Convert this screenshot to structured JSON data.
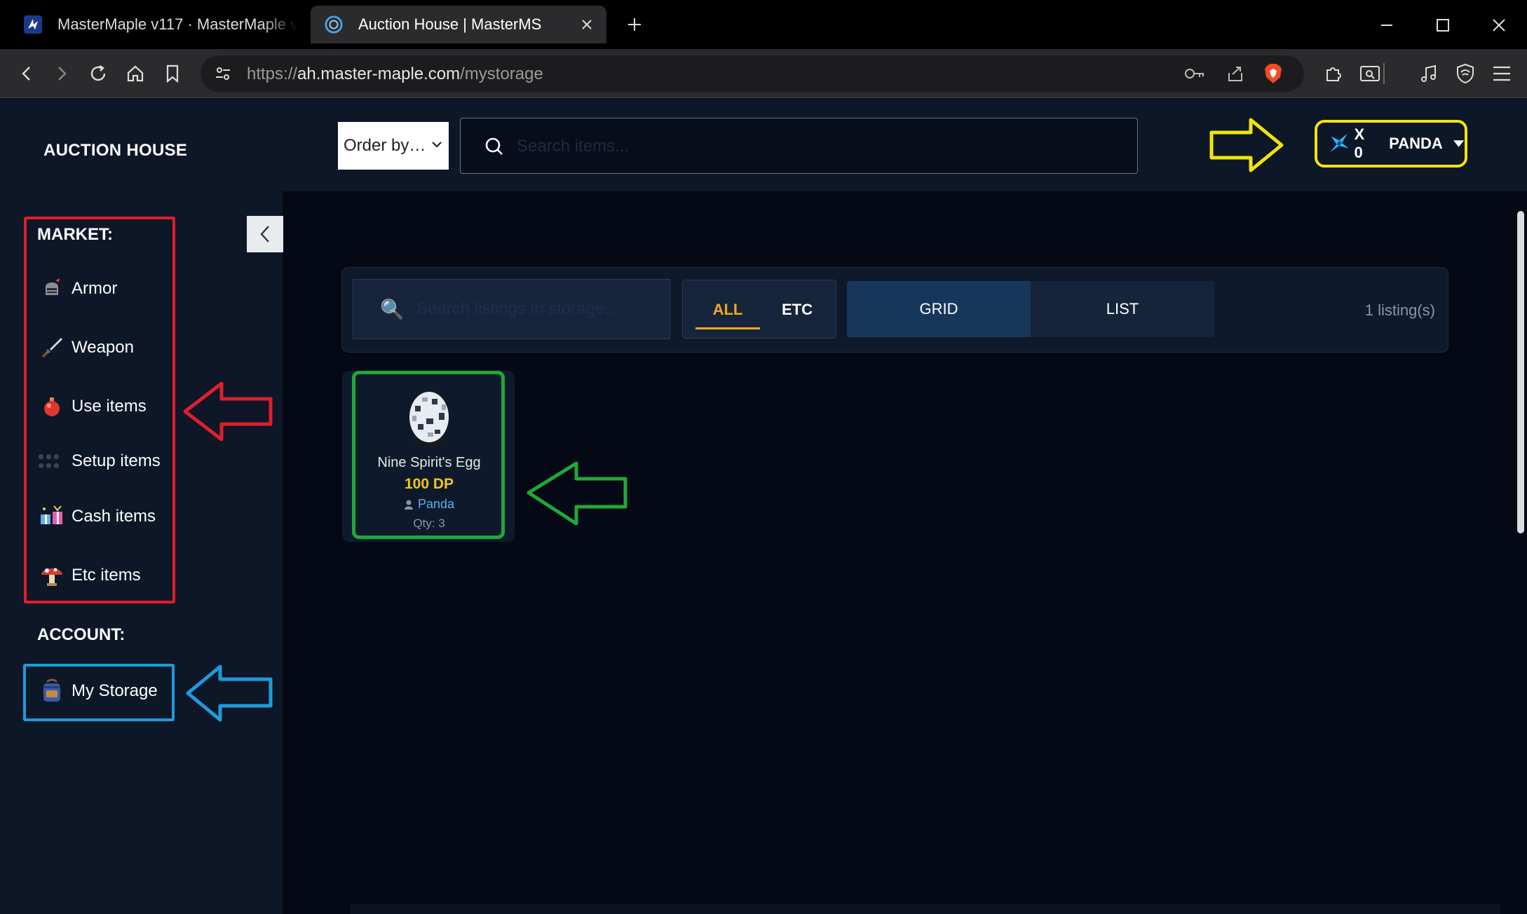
{
  "browser": {
    "tabs": [
      {
        "title": "MasterMaple v117 · MasterMaple v117",
        "active": false
      },
      {
        "title": "Auction House | MasterMS",
        "active": true
      }
    ],
    "url": {
      "scheme": "https://",
      "host": "ah.master-maple.com",
      "path": "/mystorage"
    }
  },
  "app": {
    "brand": "AUCTION HOUSE",
    "sidebar": {
      "market_title": "MARKET:",
      "market_items": [
        {
          "label": "Armor",
          "icon": "armor-icon"
        },
        {
          "label": "Weapon",
          "icon": "sword-icon"
        },
        {
          "label": "Use items",
          "icon": "potion-icon"
        },
        {
          "label": "Setup items",
          "icon": "setup-dots-icon"
        },
        {
          "label": "Cash items",
          "icon": "gift-icon"
        },
        {
          "label": "Etc items",
          "icon": "mushroom-icon"
        }
      ],
      "account_title": "ACCOUNT:",
      "account_items": [
        {
          "label": "My Storage",
          "icon": "backpack-icon"
        }
      ]
    },
    "topbar": {
      "order_by": "Order by…",
      "search_placeholder": "Search items...",
      "user": {
        "currency_count": "X 0",
        "username": "PANDA"
      }
    },
    "filters": {
      "search_placeholder": "Search listings in storage...",
      "categories": [
        {
          "label": "ALL",
          "active": true
        },
        {
          "label": "ETC",
          "active": false
        }
      ],
      "views": [
        {
          "label": "GRID",
          "active": true
        },
        {
          "label": "LIST",
          "active": false
        }
      ],
      "listing_count": "1 listing(s)"
    },
    "listings": [
      {
        "name": "Nine Spirit's Egg",
        "price": "100 DP",
        "seller": "Panda",
        "qty": "Qty: 3"
      }
    ]
  },
  "colors": {
    "accent_orange": "#f5a623",
    "price_yellow": "#f5c518",
    "seller_blue": "#5aaef0",
    "annotation_red": "#e01e2c",
    "annotation_blue": "#1e9bdc",
    "annotation_green": "#1fa83a",
    "annotation_yellow": "#f3e30c"
  }
}
